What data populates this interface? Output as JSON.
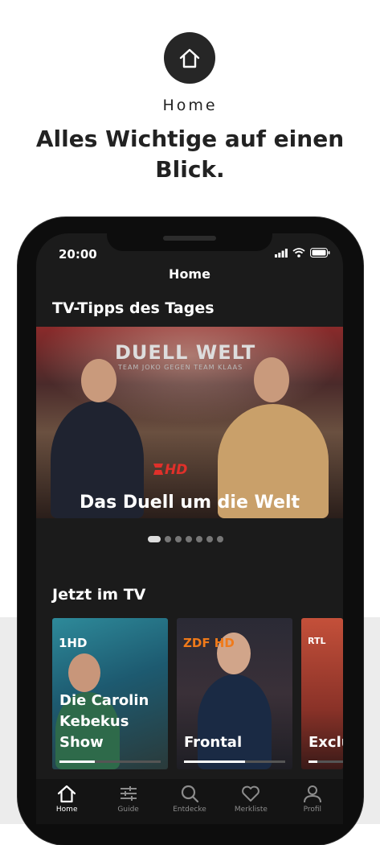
{
  "promo": {
    "icon": "home-icon",
    "label": "Home",
    "headline": "Alles Wichtige auf einen Blick."
  },
  "status_bar": {
    "time": "20:00",
    "icons": [
      "signal-icon",
      "wifi-icon",
      "battery-icon"
    ]
  },
  "top_bar": {
    "title": "Home"
  },
  "tips": {
    "heading": "TV-Tipps des Tages",
    "hero": {
      "brand": "DUELL WELT",
      "brand_sub": "TEAM JOKO GEGEN TEAM KLAAS",
      "channel": "HD",
      "title": "Das Duell um die Welt"
    },
    "carousel": {
      "count": 7,
      "active_index": 0
    }
  },
  "now_on_tv": {
    "heading": "Jetzt im TV",
    "items": [
      {
        "channel": "1HD",
        "title": "Die Carolin Kebekus Show",
        "progress": 0.35
      },
      {
        "channel": "ZDF HD",
        "title": "Frontal",
        "progress": 0.6
      },
      {
        "channel": "RTL",
        "title": "Exclu",
        "progress": 0.25
      }
    ]
  },
  "tab_bar": {
    "items": [
      {
        "label": "Home",
        "icon": "home-icon",
        "active": true
      },
      {
        "label": "Guide",
        "icon": "guide-icon",
        "active": false
      },
      {
        "label": "Entdecke",
        "icon": "search-icon",
        "active": false
      },
      {
        "label": "Merkliste",
        "icon": "heart-icon",
        "active": false
      },
      {
        "label": "Profil",
        "icon": "profile-icon",
        "active": false
      }
    ]
  },
  "colors": {
    "screen_bg": "#1b1b1b",
    "tabbar_bg": "#141414",
    "accent_red": "#e0302a",
    "text": "#ffffff"
  }
}
